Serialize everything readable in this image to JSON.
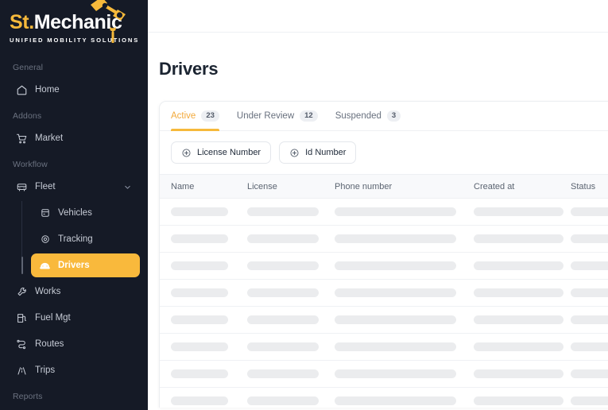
{
  "brand": {
    "logo_st": "St.",
    "logo_mechanic": "Mechanic",
    "tagline": "UNIFIED MOBILITY SOLUTIONS",
    "accent_color": "#F6B93B",
    "sidebar_bg": "#151A26"
  },
  "sidebar": {
    "sections": [
      {
        "title": "General",
        "items": [
          {
            "label": "Home",
            "icon": "home-icon",
            "active": false
          }
        ]
      },
      {
        "title": "Addons",
        "items": [
          {
            "label": "Market",
            "icon": "cart-icon",
            "active": false
          }
        ]
      },
      {
        "title": "Workflow",
        "items": [
          {
            "label": "Fleet",
            "icon": "bus-icon",
            "active": false,
            "expanded": true,
            "chevron": "chevron-down-icon"
          },
          {
            "label": "Vehicles",
            "icon": "vehicle-icon",
            "active": false,
            "sub": true
          },
          {
            "label": "Tracking",
            "icon": "tracking-icon",
            "active": false,
            "sub": true
          },
          {
            "label": "Drivers",
            "icon": "driver-icon",
            "active": true,
            "sub": true
          },
          {
            "label": "Works",
            "icon": "wrench-icon",
            "active": false
          },
          {
            "label": "Fuel Mgt",
            "icon": "fuel-pump-icon",
            "active": false
          },
          {
            "label": "Routes",
            "icon": "route-icon",
            "active": false
          },
          {
            "label": "Trips",
            "icon": "road-icon",
            "active": false
          }
        ]
      },
      {
        "title": "Reports",
        "items": []
      }
    ]
  },
  "page": {
    "title": "Drivers"
  },
  "tabs": [
    {
      "label": "Active",
      "count": "23",
      "selected": true
    },
    {
      "label": "Under Review",
      "count": "12",
      "selected": false
    },
    {
      "label": "Suspended",
      "count": "3",
      "selected": false
    }
  ],
  "filters": [
    {
      "label": "License Number",
      "icon": "plus-circle-icon"
    },
    {
      "label": "Id Number",
      "icon": "plus-circle-icon"
    }
  ],
  "table": {
    "columns": [
      "Name",
      "License",
      "Phone number",
      "Created at",
      "Status"
    ],
    "row_count": 8,
    "loading": true
  }
}
